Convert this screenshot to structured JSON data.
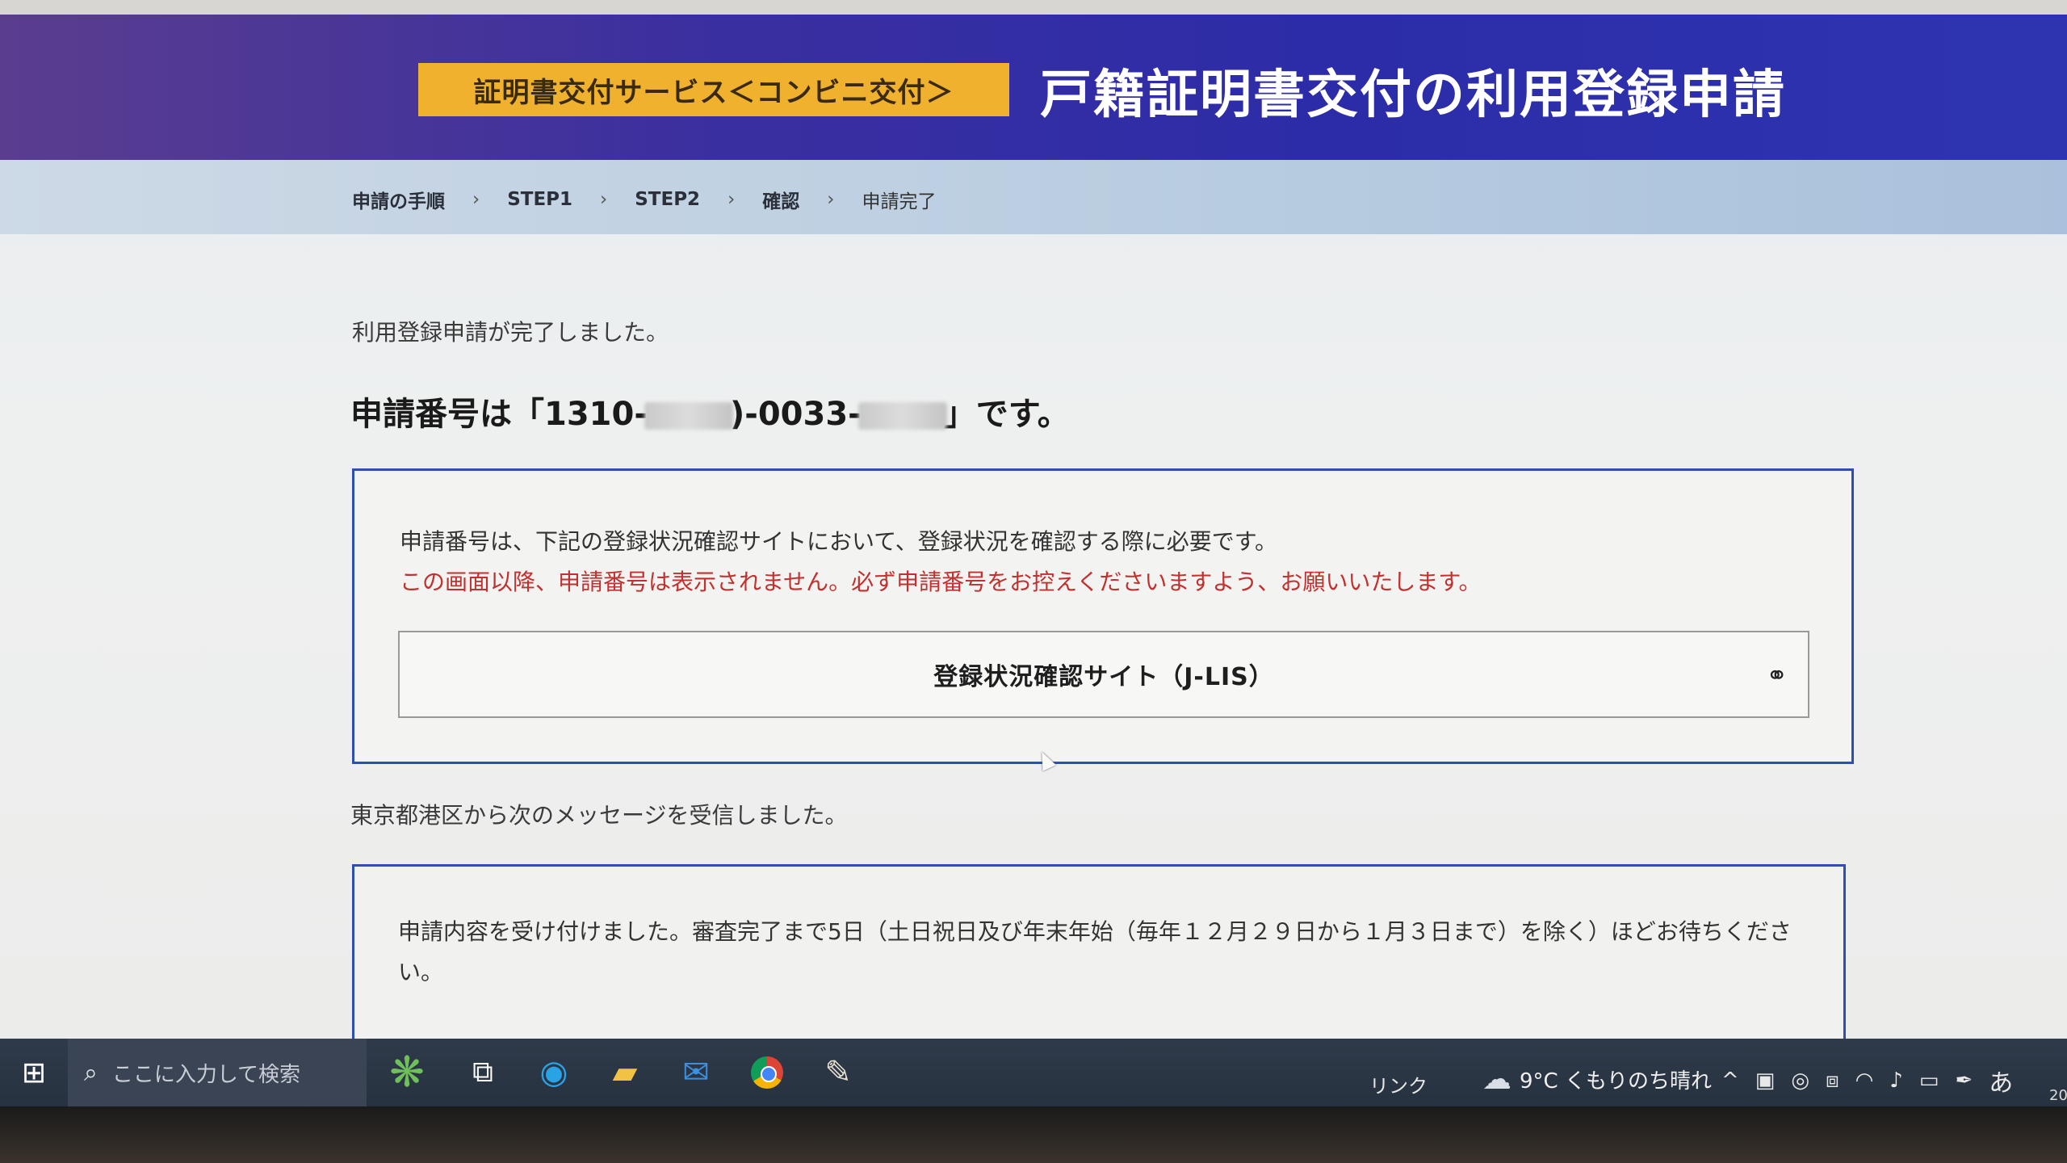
{
  "service_badge": "証明書交付サービス＜コンビニ交付＞",
  "banner_title": "戸籍証明書交付の利用登録申請",
  "breadcrumb": {
    "items": [
      "申請の手順",
      "STEP1",
      "STEP2",
      "確認",
      "申請完了"
    ],
    "separator": "›"
  },
  "complete_message": "利用登録申請が完了しました。",
  "application_number": {
    "prefix": "申請番号は「1310-",
    "mid1": ")-0033-",
    "suffix": "」です。"
  },
  "notice": {
    "line1": "申請番号は、下記の登録状況確認サイトにおいて、登録状況を確認する際に必要です。",
    "warning": "この画面以降、申請番号は表示されません。必ず申請番号をお控えくださいますよう、お願いいたします。",
    "button_label": "登録状況確認サイト（J-LIS）",
    "button_icon": "link-icon"
  },
  "received_message": "東京都港区から次のメッセージを受信しました。",
  "message_body": "申請内容を受け付けました。審査完了まで5日（土日祝日及び年末年始（毎年１２月２９日から１月３日まで）を除く）ほどお待ちください。",
  "taskbar": {
    "search_placeholder": "ここに入力して検索",
    "link_label": "リンク",
    "weather": "9°C くもりのち晴れ",
    "ime": "あ",
    "clock_fragment": "20"
  },
  "colors": {
    "badge": "#f0b12e",
    "banner": "#2c2ca8",
    "box_border": "#2f4fb0",
    "warning": "#c0312f"
  }
}
